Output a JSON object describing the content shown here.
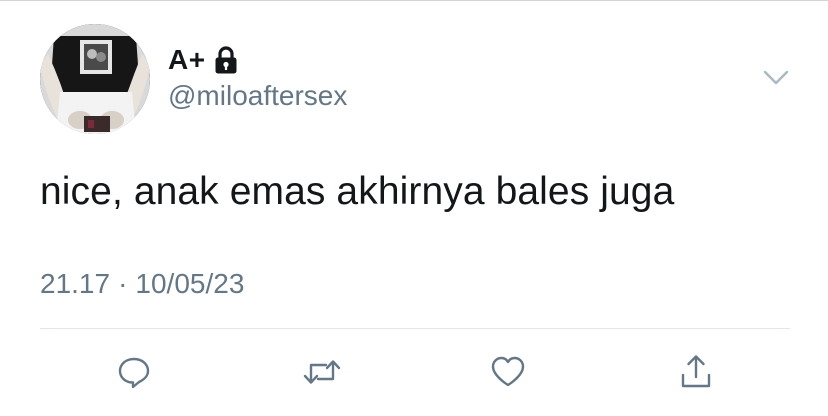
{
  "tweet": {
    "display_name": "A+",
    "handle": "@miloaftersex",
    "text": "nice, anak emas akhirnya bales juga",
    "time": "21.17",
    "separator": "·",
    "date": "10/05/23",
    "protected": true
  },
  "actions": [
    {
      "name": "reply",
      "icon": "speech-bubble-icon"
    },
    {
      "name": "retweet",
      "icon": "retweet-arrows-icon"
    },
    {
      "name": "like",
      "icon": "heart-icon"
    },
    {
      "name": "share",
      "icon": "share-arrow-up-icon"
    }
  ],
  "colors": {
    "text_primary": "#14171a",
    "text_secondary": "#657786",
    "divider": "#e1e8ed",
    "icon": "#657786"
  }
}
